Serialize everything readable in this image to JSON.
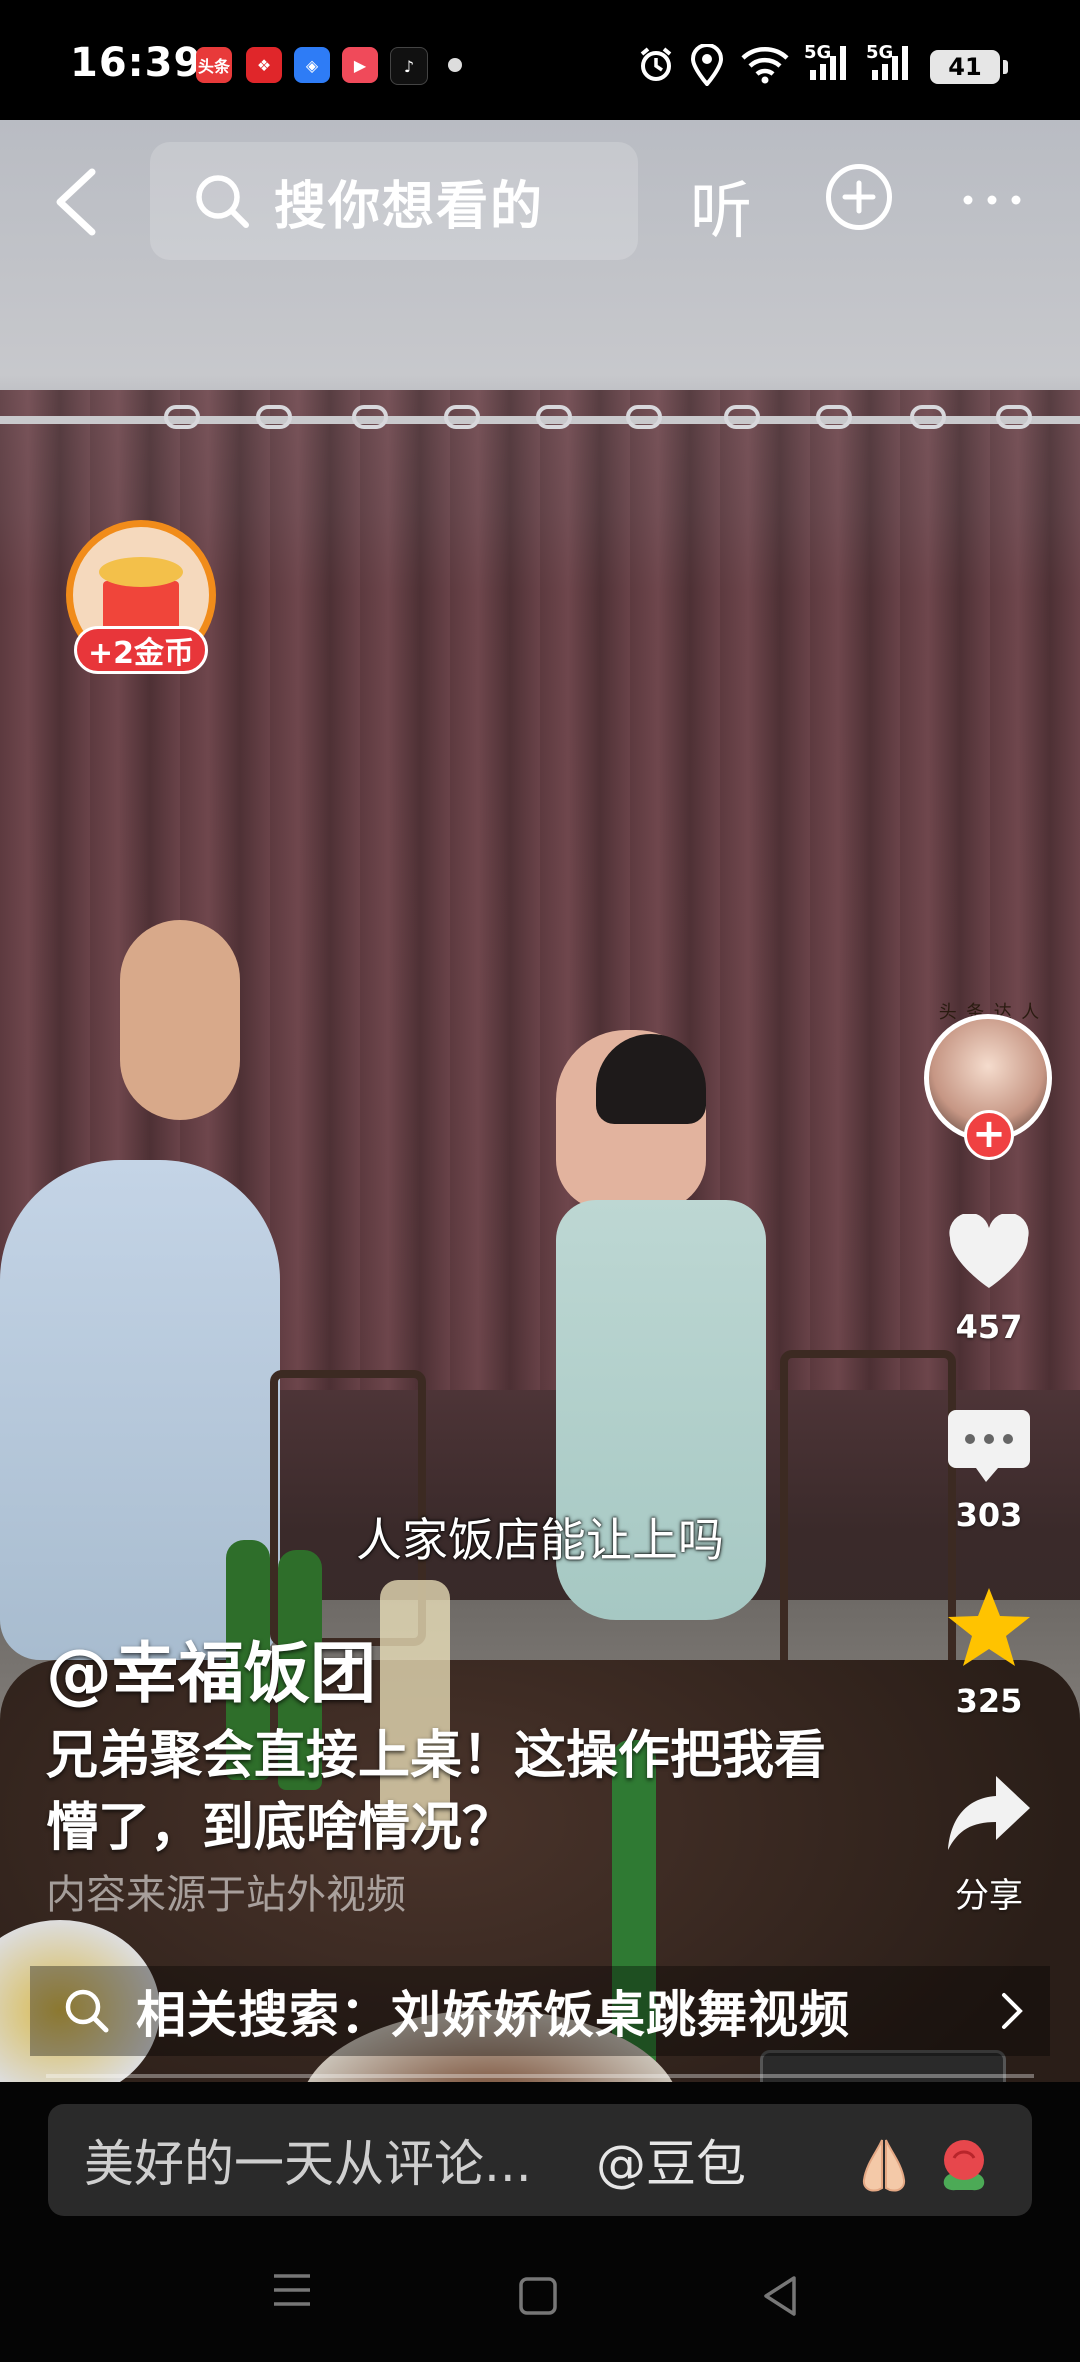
{
  "status_bar": {
    "time": "16:39",
    "app_icons": [
      {
        "name": "toutiao-app-icon",
        "label": "头条",
        "color": "#e83a3a"
      },
      {
        "name": "knot-app-icon",
        "label": "",
        "color": "#e0262a"
      },
      {
        "name": "browser-app-icon",
        "label": "",
        "color": "#2e7cf6"
      },
      {
        "name": "video-app-icon",
        "label": "",
        "color": "#f04a5a"
      },
      {
        "name": "tiktok-app-icon",
        "label": "",
        "color": "#111111"
      }
    ],
    "network": "5G",
    "network2": "5G",
    "battery": "41"
  },
  "top_bar": {
    "search_placeholder": "搜你想看的",
    "listen_label": "听"
  },
  "coin_reward": {
    "label": "+2金币"
  },
  "creator_badge": {
    "crown_text": [
      "头",
      "条",
      "达",
      "人"
    ]
  },
  "actions": {
    "likes": "457",
    "comments": "303",
    "favorites": "325",
    "share_label": "分享"
  },
  "video": {
    "subtitle": "人家饭店能让上吗",
    "author": "@幸福饭团",
    "description": "兄弟聚会直接上桌！这操作把我看懵了，到底啥情况？",
    "source_note": "内容来源于站外视频",
    "related_search": "相关搜索：刘娇娇饭桌跳舞视频"
  },
  "comment_bar": {
    "placeholder": "美好的一天从评论...",
    "mention": "@豆包"
  },
  "colors": {
    "accent_red": "#f04142",
    "coin_orange": "#f18c1a",
    "favorite_yellow": "#ffc300"
  }
}
